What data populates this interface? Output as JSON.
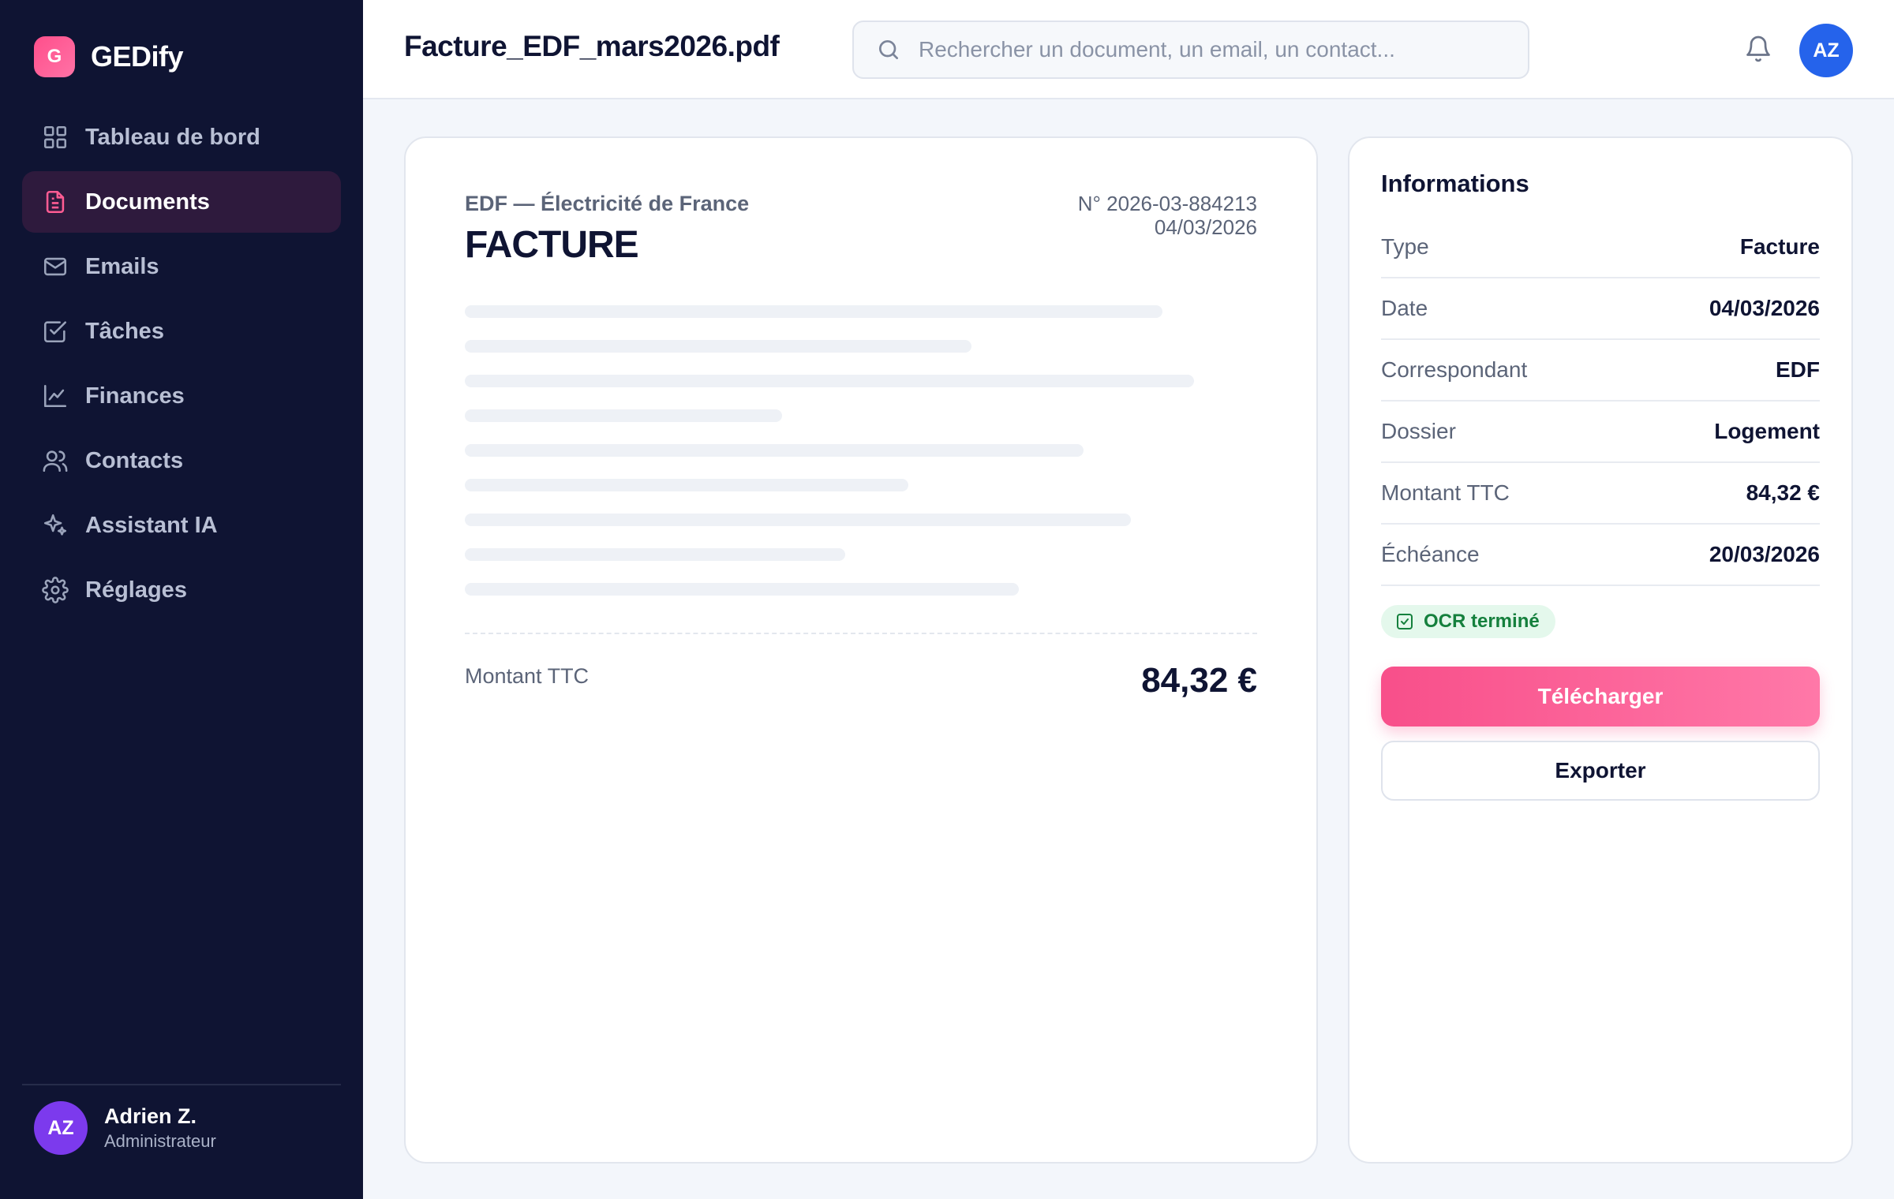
{
  "app": {
    "name": "GEDify",
    "logo_letter": "G"
  },
  "sidebar": {
    "items": [
      {
        "label": "Tableau de bord",
        "icon": "dashboard-icon",
        "active": false
      },
      {
        "label": "Documents",
        "icon": "document-icon",
        "active": true
      },
      {
        "label": "Emails",
        "icon": "mail-icon",
        "active": false
      },
      {
        "label": "Tâches",
        "icon": "checkbox-icon",
        "active": false
      },
      {
        "label": "Finances",
        "icon": "chart-line-icon",
        "active": false
      },
      {
        "label": "Contacts",
        "icon": "users-icon",
        "active": false
      },
      {
        "label": "Assistant IA",
        "icon": "sparkles-icon",
        "active": false
      },
      {
        "label": "Réglages",
        "icon": "gear-icon",
        "active": false
      }
    ],
    "user": {
      "initials": "AZ",
      "name": "Adrien Z.",
      "role": "Administrateur"
    }
  },
  "header": {
    "title": "Facture_EDF_mars2026.pdf",
    "search_placeholder": "Rechercher un document, un email, un contact...",
    "avatar_initials": "AZ"
  },
  "document": {
    "issuer": "EDF — Électricité de France",
    "type": "FACTURE",
    "number": "N° 2026-03-884213",
    "date": "04/03/2026",
    "total_label": "Montant TTC",
    "total_value": "84,32 €"
  },
  "info": {
    "title": "Informations",
    "rows": [
      {
        "key": "Type",
        "value": "Facture"
      },
      {
        "key": "Date",
        "value": "04/03/2026"
      },
      {
        "key": "Correspondant",
        "value": "EDF"
      },
      {
        "key": "Dossier",
        "value": "Logement"
      },
      {
        "key": "Montant TTC",
        "value": "84,32 €"
      },
      {
        "key": "Échéance",
        "value": "20/03/2026"
      }
    ],
    "ocr_status": "OCR terminé",
    "download_label": "Télécharger",
    "export_label": "Exporter"
  },
  "colors": {
    "sidebar_bg": "#0f1433",
    "accent": "#f84f8a",
    "active_item_bg": "#2e1a3d",
    "user_avatar": "#7c3aed",
    "top_avatar": "#2563eb",
    "ocr_green": "#15803d"
  }
}
